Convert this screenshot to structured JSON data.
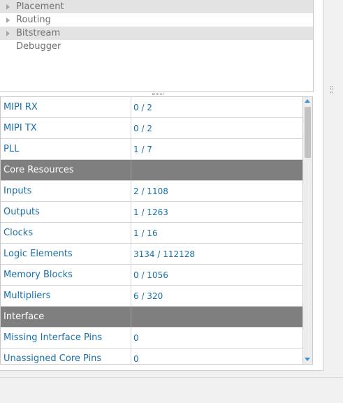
{
  "tree": {
    "items": [
      {
        "label": "Placement",
        "expandable": true,
        "shaded": true
      },
      {
        "label": "Routing",
        "expandable": true,
        "shaded": false
      },
      {
        "label": "Bitstream",
        "expandable": true,
        "shaded": true
      },
      {
        "label": "Debugger",
        "expandable": false,
        "shaded": false
      }
    ]
  },
  "resources": {
    "rows": [
      {
        "name": "MIPI RX",
        "value": "0 / 2",
        "section": false
      },
      {
        "name": "MIPI TX",
        "value": "0 / 2",
        "section": false
      },
      {
        "name": "PLL",
        "value": "1 / 7",
        "section": false
      },
      {
        "name": "Core Resources",
        "value": "",
        "section": true
      },
      {
        "name": "Inputs",
        "value": "2 / 1108",
        "section": false
      },
      {
        "name": "Outputs",
        "value": "1 / 1263",
        "section": false
      },
      {
        "name": "Clocks",
        "value": "1 / 16",
        "section": false
      },
      {
        "name": "Logic Elements",
        "value": "3134 / 112128",
        "section": false
      },
      {
        "name": "Memory Blocks",
        "value": "0 / 1056",
        "section": false
      },
      {
        "name": "Multipliers",
        "value": "6 / 320",
        "section": false
      },
      {
        "name": "Interface",
        "value": "",
        "section": true
      },
      {
        "name": "Missing Interface Pins",
        "value": "0",
        "section": false
      },
      {
        "name": "Unassigned Core Pins",
        "value": "0",
        "section": false
      }
    ]
  },
  "colors": {
    "link_text": "#1a6fa6",
    "section_bg": "#7f7f7f",
    "tree_shade": "#e3e3e3"
  }
}
